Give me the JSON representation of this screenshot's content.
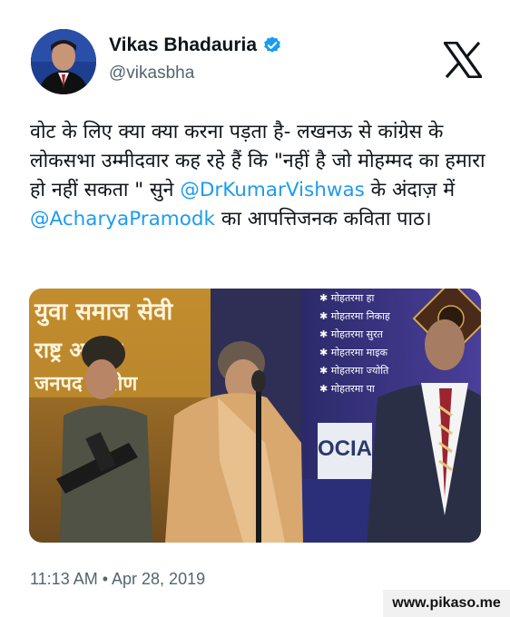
{
  "author": {
    "name": "Vikas Bhadauria",
    "handle": "@vikasbha",
    "verified_color": "#1d9bf0"
  },
  "platform_icon": "x-logo-icon",
  "tweet": {
    "text_before": "वोट के लिए क्या क्या करना पड़ता है- लखनऊ से कांग्रेस के लोकसभा उम्मीदवार कह रहे हैं कि \"नहीं है जो मोहम्मद का हमारा हो नहीं सकता \" सुने ",
    "mention_1": "@DrKumarVishwas",
    "text_middle": " के अंदाज़ में ",
    "mention_2": "@AcharyaPramodk",
    "text_after": " का आपत्तिजनक कविता पाठ।"
  },
  "media": {
    "banner_left": "युवा समाज सेवी\nराष्ट्र अध्यक्ष\nजनपद ग्रामीण",
    "banner_right": [
      "मोहतरमा हा",
      "मोहतरमा निकाह",
      "मोहतरमा सुरत",
      "मोहतरमा माइक",
      "मोहतरमा ज्योति",
      "मोहतरमा पा"
    ],
    "backdrop_text": "OCIA"
  },
  "timestamp": "11:13 AM • Apr 28, 2019",
  "watermark": "www.pikaso.me",
  "colors": {
    "mention": "#1d9bf0",
    "secondary_text": "#536471"
  }
}
